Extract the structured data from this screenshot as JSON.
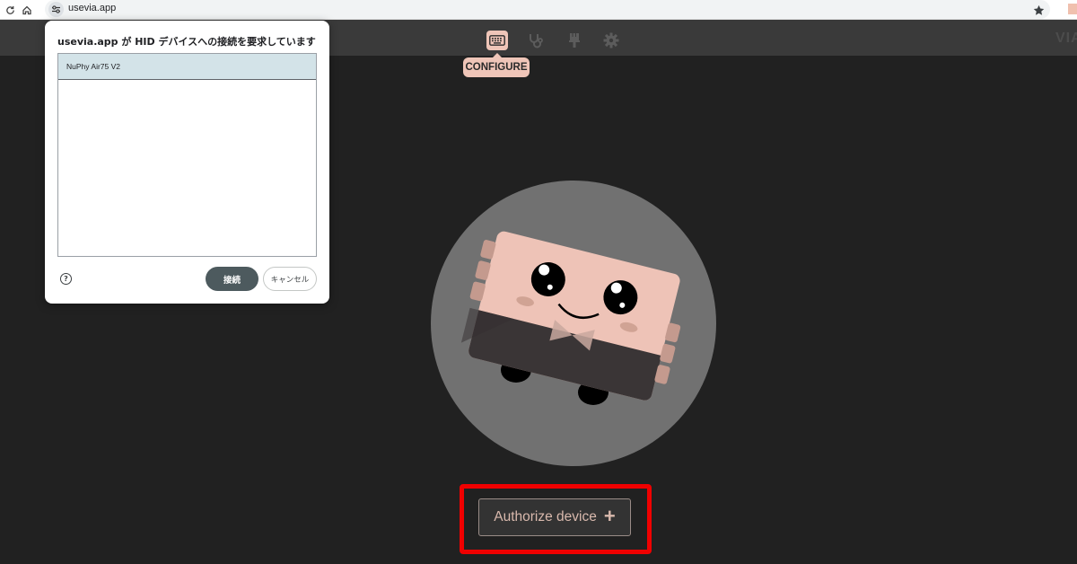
{
  "browser": {
    "url": "usevia.app",
    "icons": [
      "reload-icon",
      "home-icon",
      "site-info-icon",
      "bookmark-star-icon"
    ]
  },
  "toolbar": {
    "tools": [
      "keyboard-icon",
      "stethoscope-icon",
      "brush-icon",
      "gear-icon"
    ],
    "active_tooltip": "CONFIGURE",
    "brand": "VIA"
  },
  "dialog": {
    "title": "usevia.app が HID デバイスへの接続を要求しています",
    "devices": [
      "NuPhy Air75 V2"
    ],
    "connect_label": "接続",
    "cancel_label": "キャンセル",
    "help_glyph": "?"
  },
  "main": {
    "authorize_label": "Authorize device",
    "authorize_icon": "+"
  },
  "colors": {
    "background": "#212121",
    "accent": "#efc5b8",
    "highlight": "#f00000"
  }
}
